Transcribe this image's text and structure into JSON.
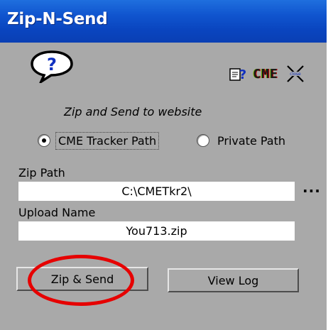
{
  "window": {
    "title": "Zip-N-Send"
  },
  "toolbar": {
    "help_icon": "question-bubble-icon",
    "notes_icon": "notepad-help-icon",
    "cme_icon_text": "CME",
    "close_icon": "close-x-icon"
  },
  "main": {
    "subtitle": "Zip and Send to website",
    "radio_options": [
      {
        "label": "CME Tracker Path",
        "selected": true
      },
      {
        "label": "Private Path",
        "selected": false
      }
    ],
    "zip_path": {
      "label": "Zip Path",
      "value": "C:\\CMETkr2\\",
      "browse_label": "..."
    },
    "upload_name": {
      "label": "Upload Name",
      "value": "You713.zip"
    },
    "buttons": {
      "zip_send": "Zip & Send",
      "view_log": "View Log"
    }
  },
  "colors": {
    "title_bar": "#0a45bf",
    "window_bg": "#a9a9a9",
    "highlight_annotation": "#e60000"
  }
}
